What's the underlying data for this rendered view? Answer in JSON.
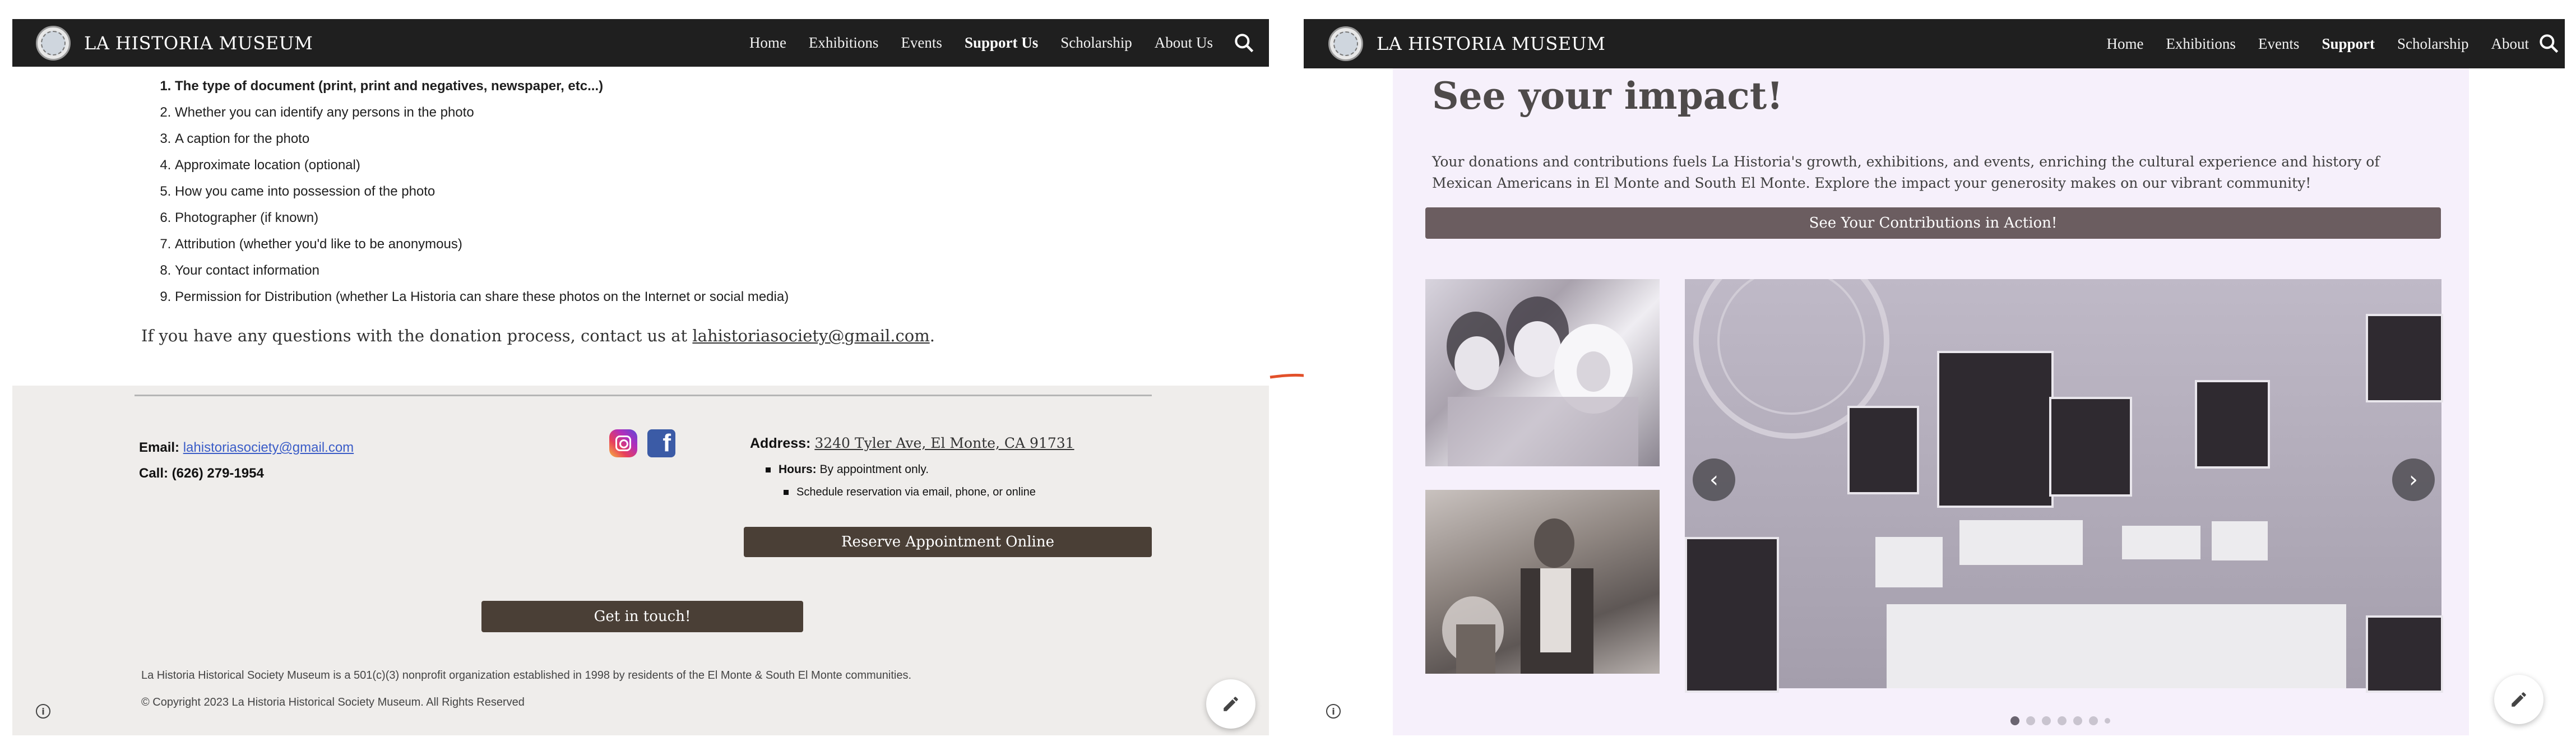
{
  "left_page": {
    "nav": {
      "site_title": "LA HISTORIA MUSEUM",
      "links": [
        "Home",
        "Exhibitions",
        "Events",
        "Support Us",
        "Scholarship",
        "About Us"
      ],
      "active_link": "Support Us"
    },
    "donation_items": [
      "The type of document (print, print and negatives, newspaper, etc...)",
      "Whether you can identify any persons in the photo",
      "A caption for the photo",
      "Approximate location (optional)",
      "How you came into possession of the photo",
      "Photographer (if known)",
      "Attribution (whether you'd like to be anonymous)",
      "Your contact information",
      "Permission for Distribution (whether La Historia can share these photos on the Internet or social media)"
    ],
    "question_text": "If you have any questions with the donation process, contact us at",
    "question_email": "lahistoriasociety@gmail.com",
    "question_end": ".",
    "footer": {
      "email_label": "Email:",
      "email": "lahistoriasociety@gmail.com",
      "call": "Call: (626) 279-1954",
      "address_label": "Address:",
      "address": "3240 Tyler Ave, El Monte, CA 91731",
      "hours_label": "Hours:",
      "hours_value": "By appointment only.",
      "hours_sub": "Schedule reservation via email, phone, or online",
      "reserve_button": "Reserve Appointment Online",
      "touch_button": "Get in touch!",
      "nonprofit": "La Historia Historical Society Museum is a 501(c)(3) nonprofit organization established in 1998 by residents of the El Monte & South El Monte communities.",
      "copyright": "© Copyright 2023 La Historia Historical Society Museum. All Rights Reserved"
    }
  },
  "right_page": {
    "nav": {
      "site_title": "LA HISTORIA MUSEUM",
      "links": [
        "Home",
        "Exhibitions",
        "Events",
        "Support",
        "Scholarship",
        "About"
      ],
      "active_link": "Support"
    },
    "title": "See your impact!",
    "body": "Your donations and contributions fuels La Historia's growth, exhibitions, and events, enriching the cultural experience and history of Mexican Americans in El Monte and South El Monte. Explore the impact your generosity makes on our vibrant community!",
    "button": "See Your Contributions in Action!",
    "carousel": {
      "slide_count": 7,
      "active_slide": 1,
      "prev_glyph": "‹",
      "next_glyph": "›"
    }
  },
  "colors": {
    "navbar": "#1f1f1f",
    "footer_bg": "#efedeb",
    "dark_button": "#4a3f36",
    "impact_bg": "#f6f0fb",
    "impact_button": "#6b5d60",
    "arrow": "#e2502a",
    "link_blue": "#3a5cc7"
  },
  "icons": {
    "search": "search-icon",
    "instagram": "instagram-icon",
    "facebook": "facebook-icon",
    "info": "info-icon",
    "edit": "pencil-icon"
  }
}
